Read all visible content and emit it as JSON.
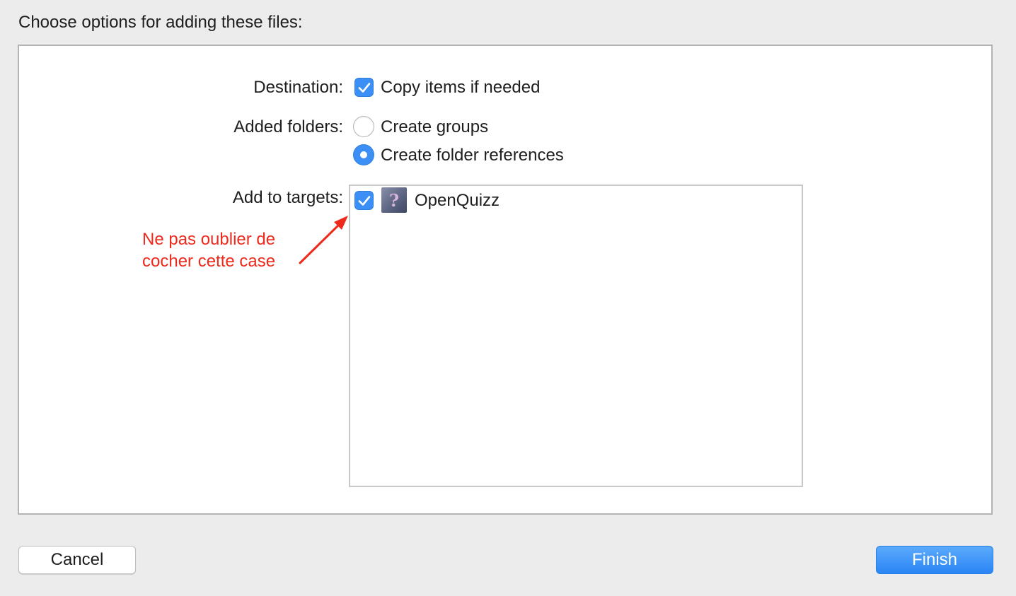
{
  "dialog": {
    "title": "Choose options for adding these files:"
  },
  "destination": {
    "label": "Destination:",
    "checkbox_label": "Copy items if needed",
    "checked": true
  },
  "added_folders": {
    "label": "Added folders:",
    "options": [
      {
        "label": "Create groups",
        "selected": false
      },
      {
        "label": "Create folder references",
        "selected": true
      }
    ]
  },
  "targets": {
    "label": "Add to targets:",
    "items": [
      {
        "name": "OpenQuizz",
        "checked": true,
        "icon": "app-question-mark-icon"
      }
    ]
  },
  "annotation": {
    "line1": "Ne pas oublier de",
    "line2": "cocher cette case",
    "color": "#ee2a1c"
  },
  "buttons": {
    "cancel": "Cancel",
    "finish": "Finish"
  },
  "colors": {
    "accent": "#3c8ff5",
    "background": "#ececec"
  }
}
